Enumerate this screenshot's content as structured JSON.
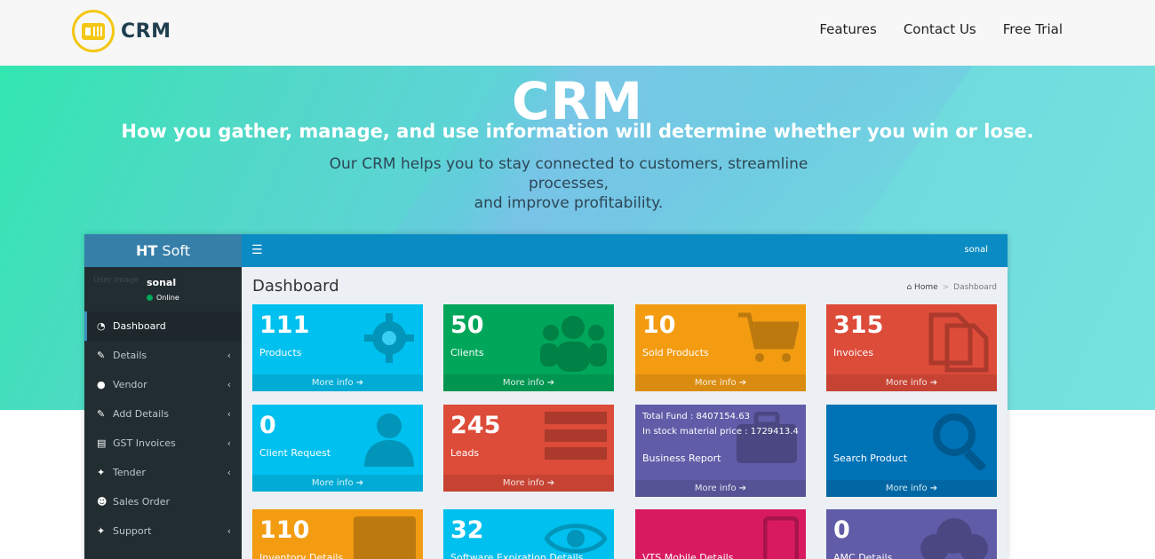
{
  "nav": {
    "brand": "CRM",
    "links": [
      "Features",
      "Contact Us",
      "Free Trial"
    ]
  },
  "hero": {
    "title": "CRM",
    "subtitle": "How you gather, manage, and use information will determine whether you win or lose.",
    "desc_line1": "Our CRM helps you to stay connected to customers, streamline processes,",
    "desc_line2": "and improve profitability."
  },
  "app": {
    "brand_bold": "HT",
    "brand_rest": " Soft",
    "user_image_alt": "User Image",
    "user_name": "sonal",
    "user_status": "Online",
    "top_user": "sonal",
    "menu": [
      {
        "label": "Dashboard",
        "icon": "dashboard-icon",
        "chevron": false,
        "active": true
      },
      {
        "label": "Details",
        "icon": "edit-icon",
        "chevron": true
      },
      {
        "label": "Vendor",
        "icon": "user-icon",
        "chevron": true
      },
      {
        "label": "Add Details",
        "icon": "edit-icon",
        "chevron": true
      },
      {
        "label": "GST Invoices",
        "icon": "file-icon",
        "chevron": true
      },
      {
        "label": "Tender",
        "icon": "wrench-icon",
        "chevron": true
      },
      {
        "label": "Sales Order",
        "icon": "users-icon",
        "chevron": false
      },
      {
        "label": "Support",
        "icon": "wrench-icon",
        "chevron": true
      }
    ],
    "page_title": "Dashboard",
    "breadcrumb": {
      "home": "Home",
      "current": "Dashboard"
    },
    "more_info": "More info",
    "colors": {
      "aqua": "#00c0ef",
      "green": "#00a65a",
      "orange": "#f39c12",
      "red": "#dd4b39",
      "purple": "#605ca8",
      "blue": "#0073b7",
      "pink": "#d81b60"
    },
    "boxes": [
      {
        "num": "111",
        "label": "Products",
        "color": "#00c0ef",
        "icon": "gear-icon"
      },
      {
        "num": "50",
        "label": "Clients",
        "color": "#00a65a",
        "icon": "users-icon"
      },
      {
        "num": "10",
        "label": "Sold Products",
        "color": "#f39c12",
        "icon": "cart-icon"
      },
      {
        "num": "315",
        "label": "Invoices",
        "color": "#dd4b39",
        "icon": "files-icon"
      },
      {
        "num": "0",
        "label": "Client Request",
        "color": "#00c0ef",
        "icon": "user-icon"
      },
      {
        "num": "245",
        "label": "Leads",
        "color": "#dd4b39",
        "icon": "list-icon"
      },
      {
        "line1": "Total Fund : 8407154.63",
        "line2": "In stock material price : 1729413.4",
        "label": "Business Report",
        "color": "#605ca8",
        "icon": "briefcase-icon"
      },
      {
        "label": "Search Product",
        "color": "#0073b7",
        "icon": "search-icon"
      },
      {
        "num": "110",
        "label": "Inventory Details",
        "color": "#f39c12",
        "icon": "table-icon"
      },
      {
        "num": "32",
        "label": "Software Expiration Details",
        "color": "#00c0ef",
        "icon": "eye-icon"
      },
      {
        "label": "VTS Mobile Details",
        "color": "#d81b60",
        "icon": "mobile-icon"
      },
      {
        "num": "0",
        "label": "AMC Details",
        "color": "#605ca8",
        "icon": "cloud-icon"
      }
    ]
  }
}
